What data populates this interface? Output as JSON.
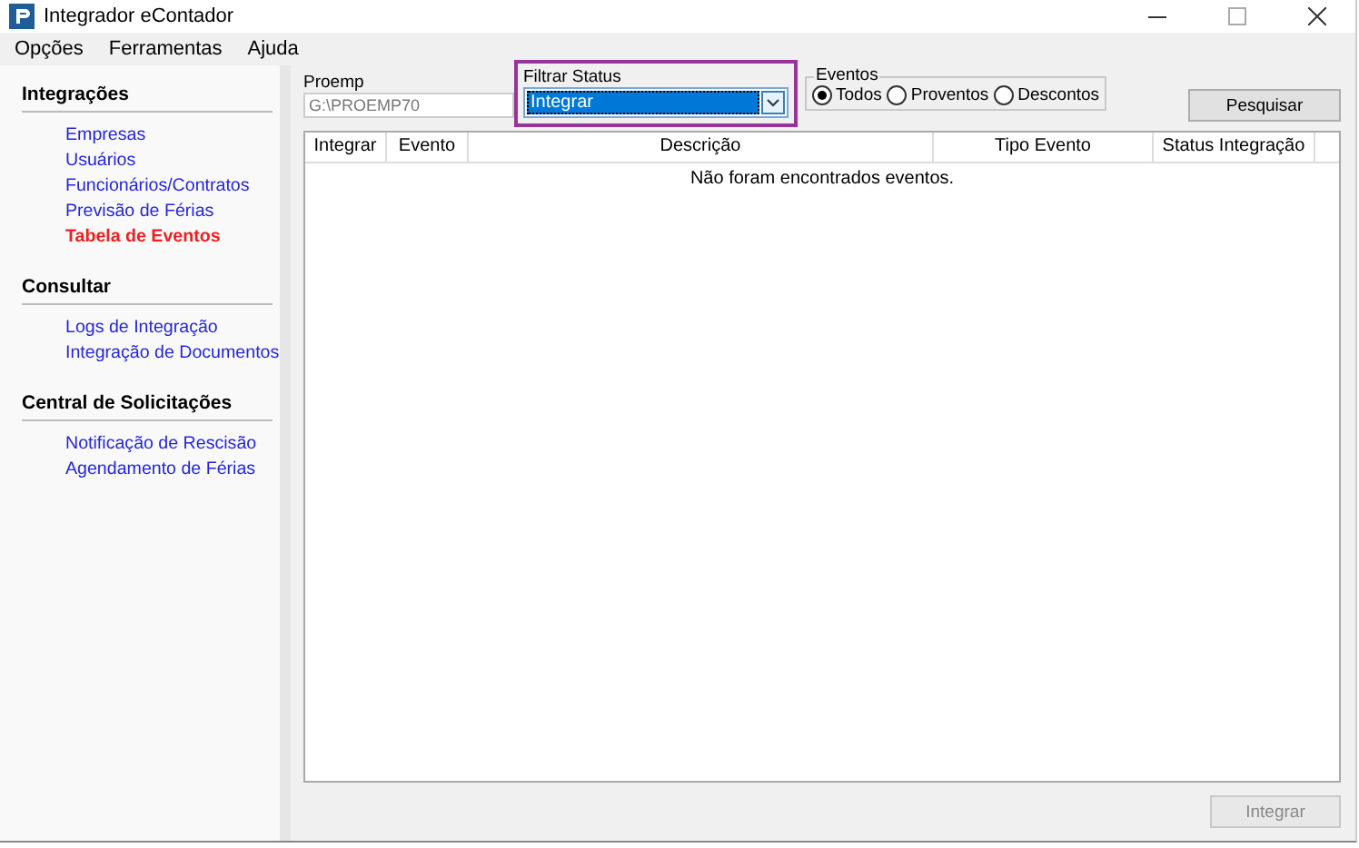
{
  "window": {
    "title": "Integrador eContador"
  },
  "menu": [
    "Opções",
    "Ferramentas",
    "Ajuda"
  ],
  "sidebar": {
    "sections": [
      {
        "title": "Integrações",
        "items": [
          {
            "label": "Empresas",
            "selected": false
          },
          {
            "label": "Usuários",
            "selected": false
          },
          {
            "label": "Funcionários/Contratos",
            "selected": false
          },
          {
            "label": "Previsão de Férias",
            "selected": false
          },
          {
            "label": "Tabela de Eventos",
            "selected": true
          }
        ]
      },
      {
        "title": "Consultar",
        "items": [
          {
            "label": "Logs de Integração",
            "selected": false
          },
          {
            "label": "Integração de Documentos",
            "selected": false
          }
        ]
      },
      {
        "title": "Central de Solicitações",
        "items": [
          {
            "label": "Notificação de Rescisão",
            "selected": false
          },
          {
            "label": "Agendamento de Férias",
            "selected": false
          }
        ]
      }
    ]
  },
  "proemp": {
    "label": "Proemp",
    "value": "G:\\PROEMP70"
  },
  "filter_status": {
    "label": "Filtrar Status",
    "value": "Integrar"
  },
  "eventos": {
    "label": "Eventos",
    "options": [
      {
        "label": "Todos",
        "selected": true
      },
      {
        "label": "Proventos",
        "selected": false
      },
      {
        "label": "Descontos",
        "selected": false
      }
    ]
  },
  "search_button": "Pesquisar",
  "table": {
    "columns": [
      "Integrar",
      "Evento",
      "Descrição",
      "Tipo Evento",
      "Status Integração"
    ],
    "empty_message": "Não foram encontrados eventos."
  },
  "integrate_button": {
    "label": "Integrar",
    "disabled": true
  }
}
